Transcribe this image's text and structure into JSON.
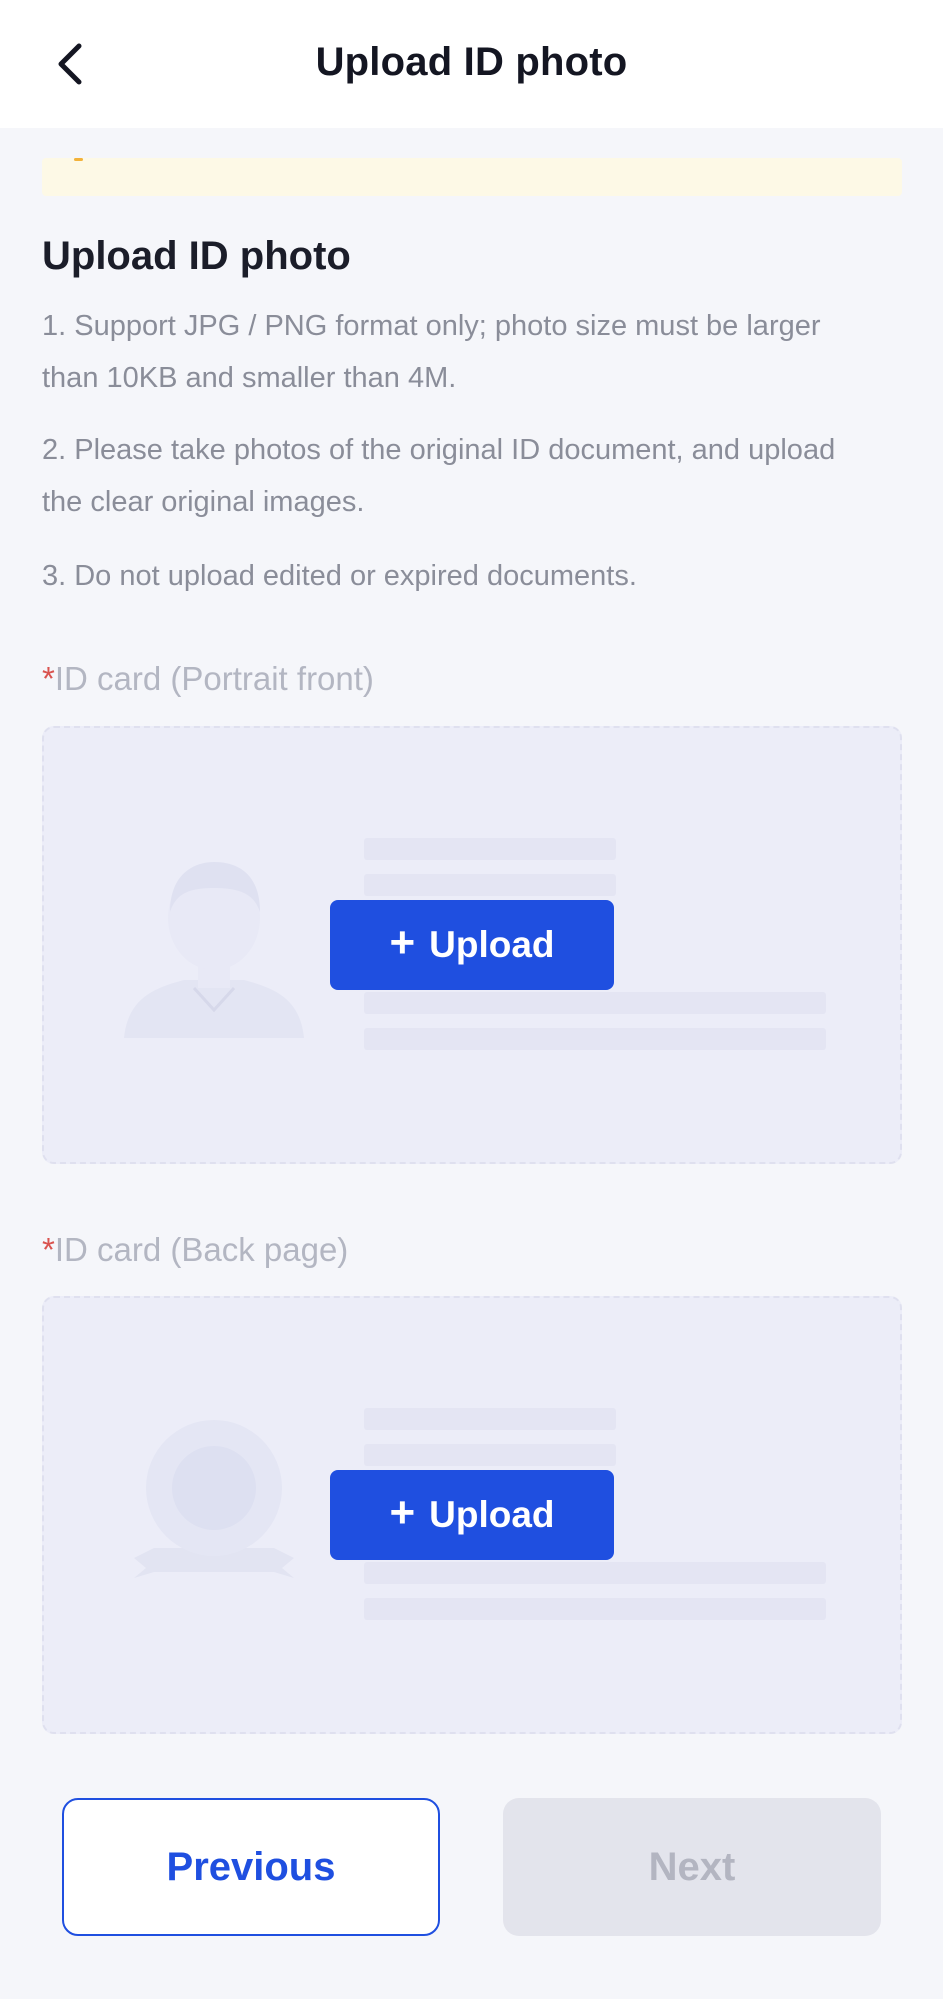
{
  "header": {
    "title": "Upload ID photo",
    "back_icon": "chevron-left-icon"
  },
  "notice": {
    "text": ""
  },
  "section": {
    "title": "Upload ID photo",
    "rules": [
      "1. Support JPG / PNG format only; photo size must be larger than 10KB and smaller than 4M.",
      "2. Please take photos of the original ID document, and upload the clear original images.",
      "3. Do not upload edited or expired documents."
    ]
  },
  "fields": [
    {
      "required_mark": "*",
      "label": "ID card (Portrait front)",
      "illustration_icon": "portrait-placeholder-icon",
      "upload_label": "Upload",
      "upload_icon": "plus-icon"
    },
    {
      "required_mark": "*",
      "label": "ID card (Back page)",
      "illustration_icon": "emblem-placeholder-icon",
      "upload_label": "Upload",
      "upload_icon": "plus-icon"
    }
  ],
  "footer": {
    "previous_label": "Previous",
    "next_label": "Next"
  },
  "colors": {
    "accent": "#1f4fe0",
    "required": "#d9534f",
    "disabled_bg": "#e3e4ec",
    "disabled_text": "#b3b5c1"
  }
}
